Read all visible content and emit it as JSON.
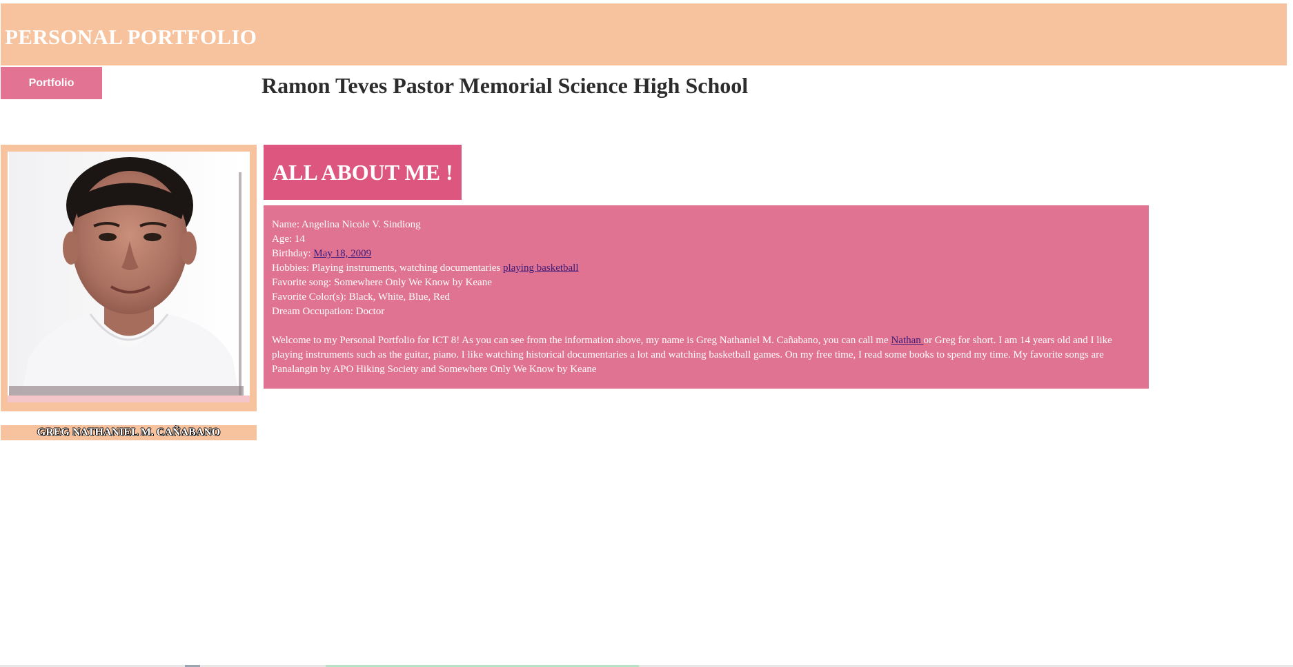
{
  "header": {
    "title": "PERSONAL PORTFOLIO"
  },
  "nav": {
    "portfolio_label": "Portfolio"
  },
  "school": {
    "title": "Ramon Teves Pastor Memorial Science High School"
  },
  "profile": {
    "name_caption": "GREG NATHANIEL M. CAÑABANO"
  },
  "about": {
    "heading": "ALL ABOUT ME !",
    "name_line": "Name: Angelina Nicole V. Sindiong",
    "age_line": "Age: 14",
    "birthday_label": "Birthday: ",
    "birthday_link": "May 18, 2009",
    "hobbies_label": "Hobbies: Playing instruments, watching documentaries ",
    "hobbies_link": "playing basketball",
    "song_line": "Favorite song: Somewhere Only We Know by Keane",
    "color_line": "Favorite Color(s): Black, White, Blue, Red",
    "dream_line": "Dream Occupation: Doctor",
    "paragraph_part1": "Welcome to my Personal Portfolio for ICT 8! As you can see from the information above, my name is Greg Nathaniel M. Cañabano, you can call me ",
    "paragraph_link": "Nathan ",
    "paragraph_part2": "or Greg for short. I am 14 years old and I like playing instruments such as the guitar, piano. I like watching historical documentaries a lot and watching basketball games. On my free time, I read some books to spend my time. My favorite songs are Panalangin by APO Hiking Society and Somewhere Only We Know by Keane"
  },
  "colors": {
    "peach": "#f7c39f",
    "pink": "#e17392",
    "deep_pink": "#dc5680",
    "link": "#3b1a7a"
  }
}
